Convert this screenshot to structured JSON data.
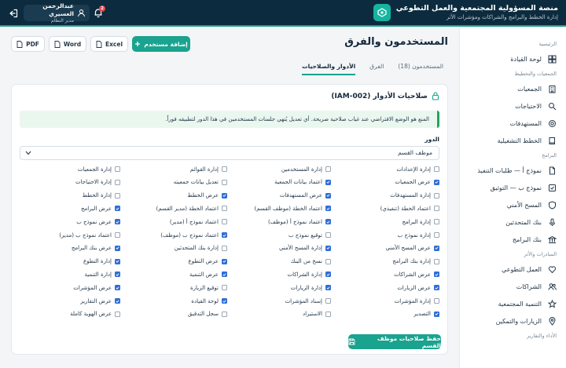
{
  "header": {
    "title": "منصة المسؤولية المجتمعية والعمل التطوعي",
    "subtitle": "إدارة الخطط والبرامج والشراكات ومؤشرات الأثر",
    "user_name": "عبدالرحمن العسيري",
    "user_role": "مدير النظام",
    "notifications": "2"
  },
  "sidebar": {
    "sections": [
      {
        "label": "الرئيسية",
        "items": [
          {
            "label": "لوحة القيادة",
            "icon": "dashboard-icon"
          }
        ]
      },
      {
        "label": "الجمعيات والتخطيط",
        "items": [
          {
            "label": "الجمعيات",
            "icon": "building-icon"
          },
          {
            "label": "الاحتياجات",
            "icon": "search-icon"
          },
          {
            "label": "المستهدفات",
            "icon": "target-icon"
          },
          {
            "label": "الخطط التشغيلية",
            "icon": "book-icon"
          }
        ]
      },
      {
        "label": "البرامج",
        "items": [
          {
            "label": "نموذج أ — طلبات التنفيذ",
            "icon": "file-icon"
          },
          {
            "label": "نموذج ب — التوثيق",
            "icon": "check-file-icon"
          },
          {
            "label": "المسح الأمني",
            "icon": "shield-icon"
          },
          {
            "label": "بنك المتحدثين",
            "icon": "mic-icon"
          },
          {
            "label": "بنك البرامج",
            "icon": "bank-icon"
          }
        ]
      },
      {
        "label": "المبادرات والأثر",
        "items": [
          {
            "label": "العمل التطوعي",
            "icon": "heart-icon"
          },
          {
            "label": "الشراكات",
            "icon": "users-icon"
          },
          {
            "label": "التنمية المجتمعية",
            "icon": "star-icon"
          },
          {
            "label": "الزيارات والتمكين",
            "icon": "pin-icon"
          }
        ]
      },
      {
        "label": "الأداء والتقارير",
        "items": []
      }
    ]
  },
  "page": {
    "title": "المستخدمون والفرق",
    "add_user": "إضافة مستخدم",
    "excel": "Excel",
    "word": "Word",
    "pdf": "PDF",
    "tabs": [
      "المستخدمون (18)",
      "الفرق",
      "الأدوار والصلاحيات"
    ],
    "active_tab": 2
  },
  "card": {
    "title": "صلاحيات الأدوار (IAM-002)",
    "notice": "المنع هو الوضع الافتراضي عند غياب صلاحية صريحة. أي تعديل يُنهي جلسات المستخدمين في هذا الدور لتطبيقه فوراً.",
    "role_label": "الدور",
    "role_value": "موظف القسم",
    "save_label": "حفظ صلاحيات موظف القسم"
  },
  "permissions": [
    [
      {
        "label": "إدارة الإعدادات",
        "checked": false
      },
      {
        "label": "عرض الجمعيات",
        "checked": true
      },
      {
        "label": "إدارة المستهدفات",
        "checked": false
      },
      {
        "label": "اعتماد الخطة (تنفيذي)",
        "checked": false
      },
      {
        "label": "إدارة البرامج",
        "checked": false
      },
      {
        "label": "إدارة نموذج ب",
        "checked": false
      },
      {
        "label": "عرض المسح الأمني",
        "checked": true
      },
      {
        "label": "إدارة بنك البرامج",
        "checked": false
      },
      {
        "label": "عرض الشراكات",
        "checked": true
      },
      {
        "label": "عرض الزيارات",
        "checked": true
      },
      {
        "label": "إدارة المؤشرات",
        "checked": false
      },
      {
        "label": "التصدير",
        "checked": true
      }
    ],
    [
      {
        "label": "إدارة المستخدمين",
        "checked": false
      },
      {
        "label": "اعتماد بيانات الجمعية",
        "checked": true
      },
      {
        "label": "عرض المستهدفات",
        "checked": true
      },
      {
        "label": "اعتماد الخطة (موظف القسم)",
        "checked": true
      },
      {
        "label": "اعتماد نموذج أ (موظف)",
        "checked": true
      },
      {
        "label": "توقيع نموذج ب",
        "checked": false
      },
      {
        "label": "إدارة المسح الأمني",
        "checked": true
      },
      {
        "label": "نسخ من البنك",
        "checked": false
      },
      {
        "label": "إدارة الشراكات",
        "checked": true
      },
      {
        "label": "إدارة الزيارات",
        "checked": true
      },
      {
        "label": "إسناد المؤشرات",
        "checked": false
      },
      {
        "label": "الاستيراد",
        "checked": false
      }
    ],
    [
      {
        "label": "إدارة القوائم",
        "checked": false
      },
      {
        "label": "تعديل بيانات جمعيته",
        "checked": false
      },
      {
        "label": "عرض الخطط",
        "checked": true
      },
      {
        "label": "اعتماد الخطة (مدير القسم)",
        "checked": false
      },
      {
        "label": "اعتماد نموذج أ (مدير)",
        "checked": false
      },
      {
        "label": "اعتماد نموذج ب (موظف)",
        "checked": true
      },
      {
        "label": "إدارة بنك المتحدثين",
        "checked": false
      },
      {
        "label": "عرض التطوع",
        "checked": true
      },
      {
        "label": "عرض التنمية",
        "checked": true
      },
      {
        "label": "توقيع الزيارة",
        "checked": false
      },
      {
        "label": "لوحة القيادة",
        "checked": true
      },
      {
        "label": "سجل التدقيق",
        "checked": false
      }
    ],
    [
      {
        "label": "إدارة الجمعيات",
        "checked": false
      },
      {
        "label": "إدارة الاحتياجات",
        "checked": false
      },
      {
        "label": "إدارة الخطط",
        "checked": false
      },
      {
        "label": "عرض البرامج",
        "checked": true
      },
      {
        "label": "عرض نموذج ب",
        "checked": true
      },
      {
        "label": "اعتماد نموذج ب (مدير)",
        "checked": false
      },
      {
        "label": "عرض بنك البرامج",
        "checked": true
      },
      {
        "label": "إدارة التطوع",
        "checked": true
      },
      {
        "label": "إدارة التنمية",
        "checked": true
      },
      {
        "label": "عرض المؤشرات",
        "checked": true
      },
      {
        "label": "عرض التقارير",
        "checked": true
      },
      {
        "label": "عرض الهوية كاملة",
        "checked": false
      }
    ]
  ]
}
